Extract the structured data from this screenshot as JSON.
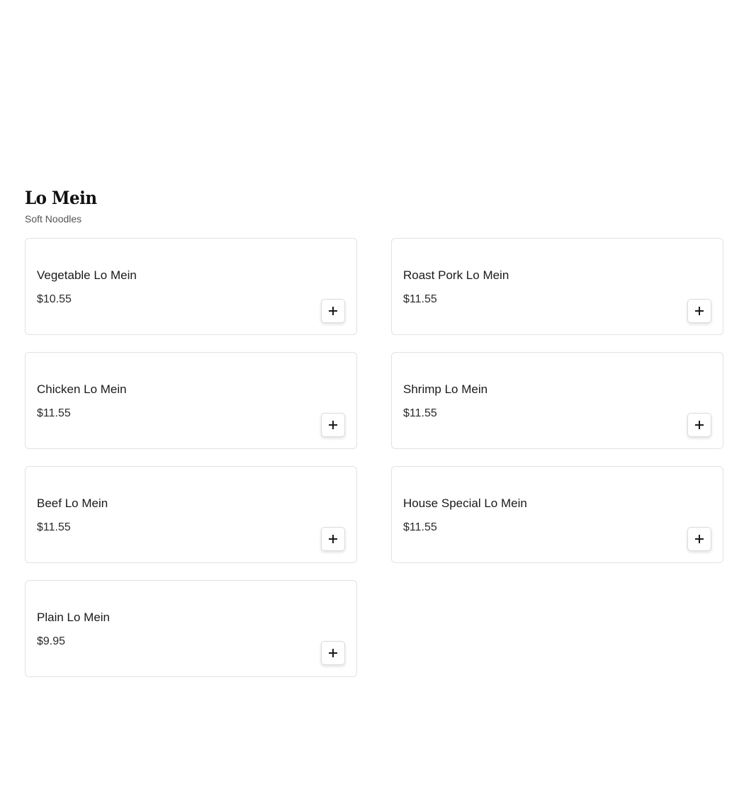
{
  "section": {
    "title": "Lo Mein",
    "subtitle": "Soft Noodles"
  },
  "items": [
    {
      "name": "Vegetable Lo Mein",
      "price": "$10.55",
      "add_icon": "plus-icon"
    },
    {
      "name": "Roast Pork Lo Mein",
      "price": "$11.55",
      "add_icon": "plus-icon"
    },
    {
      "name": "Chicken Lo Mein",
      "price": "$11.55",
      "add_icon": "plus-icon"
    },
    {
      "name": "Shrimp Lo Mein",
      "price": "$11.55",
      "add_icon": "plus-icon"
    },
    {
      "name": "Beef Lo Mein",
      "price": "$11.55",
      "add_icon": "plus-icon"
    },
    {
      "name": "House Special Lo Mein",
      "price": "$11.55",
      "add_icon": "plus-icon"
    },
    {
      "name": "Plain Lo Mein",
      "price": "$9.95",
      "add_icon": "plus-icon"
    }
  ],
  "colors": {
    "card_border": "#e2e2e2",
    "text": "#1a1a1a",
    "subtitle": "#555555"
  }
}
